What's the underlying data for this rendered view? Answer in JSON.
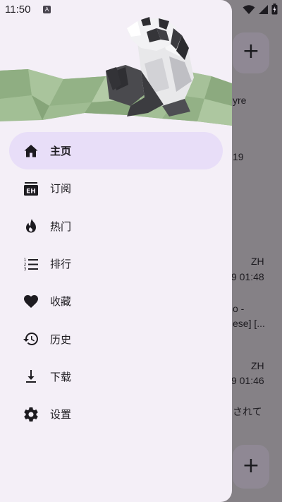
{
  "status_bar": {
    "time": "11:50",
    "notification_badge": "A",
    "icons": [
      "wifi-icon",
      "signal-icon",
      "battery-icon"
    ]
  },
  "drawer": {
    "header_image": "panda-lowpoly-illustration",
    "items": [
      {
        "label": "主页",
        "icon": "home-icon",
        "active": true
      },
      {
        "label": "订阅",
        "icon": "eh-subscription-icon",
        "active": false
      },
      {
        "label": "热门",
        "icon": "fire-icon",
        "active": false
      },
      {
        "label": "排行",
        "icon": "ranked-list-icon",
        "active": false
      },
      {
        "label": "收藏",
        "icon": "heart-icon",
        "active": false
      },
      {
        "label": "历史",
        "icon": "history-icon",
        "active": false
      },
      {
        "label": "下载",
        "icon": "download-icon",
        "active": false
      },
      {
        "label": "设置",
        "icon": "settings-icon",
        "active": false
      }
    ]
  },
  "background": {
    "fab_top_label": "+",
    "fab_bottom_label": "+",
    "snippets": {
      "s1": "yre",
      "s2": "19",
      "s3": "ZH",
      "s4": "9 01:48",
      "s5": "o -",
      "s6": "ese] [...",
      "s7": "ZH",
      "s8": "9 01:46",
      "s9": "されて"
    }
  },
  "colors": {
    "drawer_bg": "#f4eff7",
    "active_item_bg": "#e8def8",
    "scrim": "#858186",
    "icon_color": "#1d1b20"
  }
}
